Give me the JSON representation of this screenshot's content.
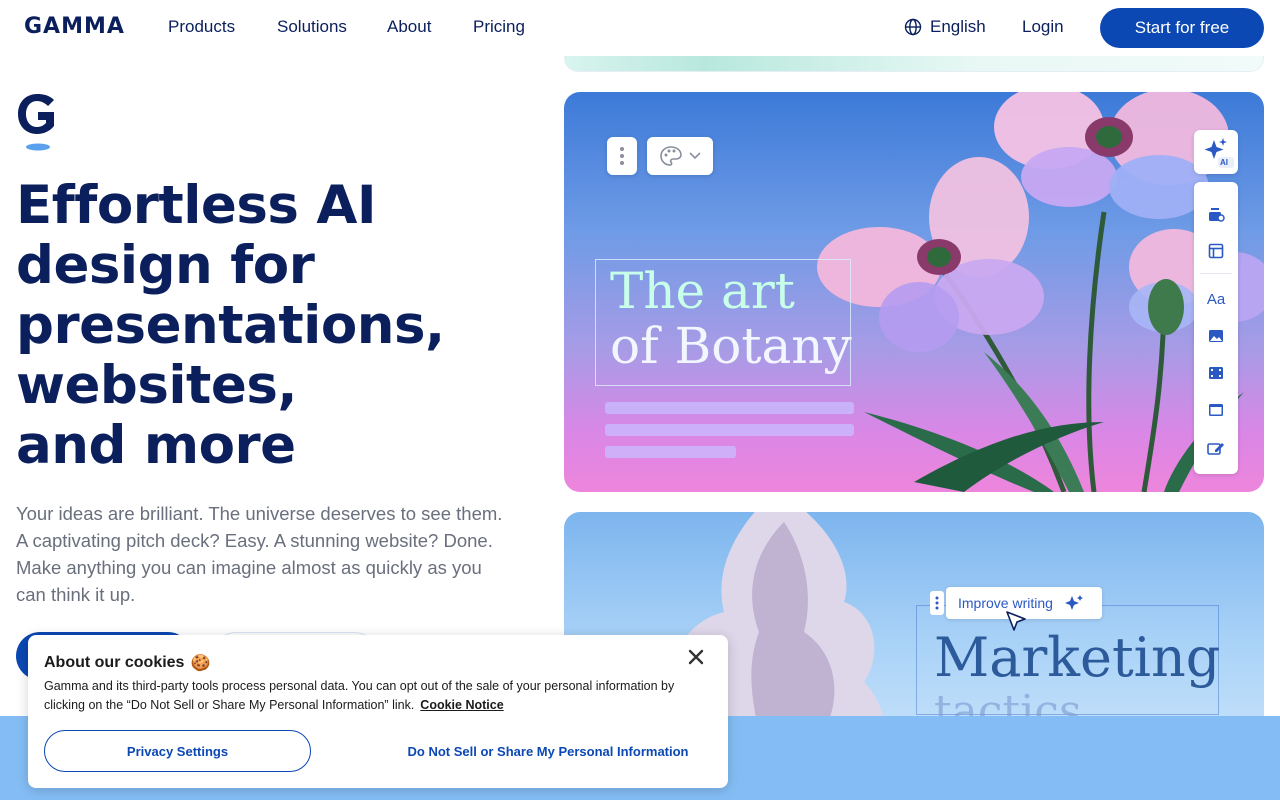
{
  "nav": {
    "logo": "GAMMA",
    "links": [
      "Products",
      "Solutions",
      "About",
      "Pricing"
    ],
    "language": "English",
    "login": "Login",
    "cta": "Start for free"
  },
  "hero": {
    "title_lines": [
      "Effortless AI",
      "design for",
      "presentations,",
      "websites,",
      "and more"
    ],
    "subtitle": "Your ideas are brilliant. The universe deserves to see them. A captivating pitch deck? Easy. A stunning website? Done. Make anything you can imagine almost as quickly as you can think it up."
  },
  "visual": {
    "card1_title_line1": "The art",
    "card1_title_line2": "of Botany",
    "ai_badge": "AI",
    "side_tool_text": "Aa",
    "improve_label": "Improve writing",
    "card2_title": "Marketing",
    "card2_title_line2": "tactics"
  },
  "cookie": {
    "title": "About our cookies",
    "emoji": "🍪",
    "text": "Gamma and its third-party tools process personal data. You can opt out of the sale of your personal information by clicking on the “Do Not Sell or Share My Personal Information” link.",
    "link": "Cookie Notice",
    "privacy_button": "Privacy Settings",
    "do_not_sell_button": "Do Not Sell or Share My Personal Information"
  },
  "colors": {
    "brand_navy": "#0a1f5c",
    "brand_blue": "#0b48b3",
    "band_blue": "#84bdf5"
  }
}
